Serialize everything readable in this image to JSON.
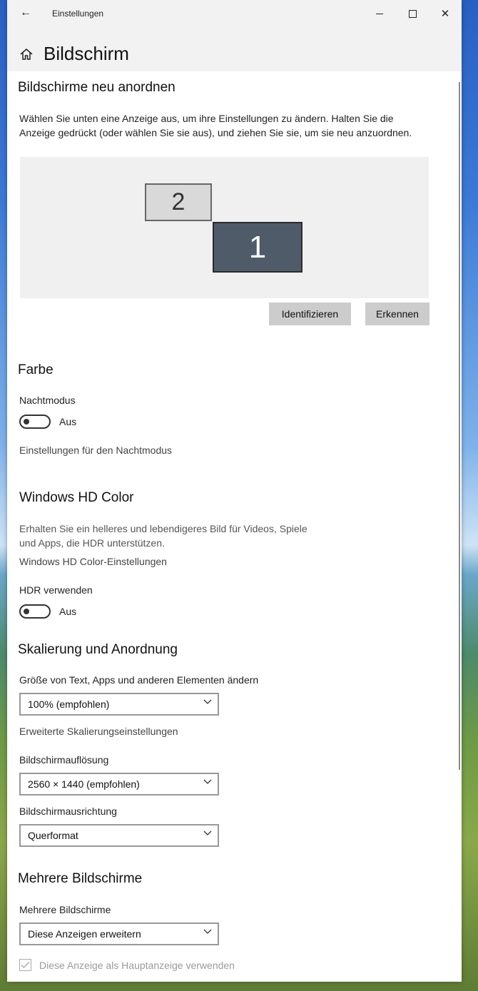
{
  "window": {
    "title": "Einstellungen"
  },
  "page": {
    "title": "Bildschirm"
  },
  "arrange": {
    "heading": "Bildschirme neu anordnen",
    "description_line1": "Wählen Sie unten eine Anzeige aus, um ihre Einstellungen zu ändern. Halten Sie die",
    "description_line2": "Anzeige gedrückt (oder wählen Sie sie aus), und ziehen Sie sie, um sie neu anzuordnen.",
    "monitors": [
      {
        "label": "2"
      },
      {
        "label": "1"
      }
    ],
    "identify_button": "Identifizieren",
    "detect_button": "Erkennen"
  },
  "color": {
    "heading": "Farbe",
    "night_mode_label": "Nachtmodus",
    "night_mode_state": "Aus",
    "night_mode_link": "Einstellungen für den Nachtmodus"
  },
  "hdr": {
    "heading": "Windows HD Color",
    "description_line1": "Erhalten Sie ein helleres und lebendigeres Bild für Videos, Spiele",
    "description_line2": "und Apps, die HDR unterstützen.",
    "settings_link": "Windows HD Color-Einstellungen",
    "use_hdr_label": "HDR verwenden",
    "use_hdr_state": "Aus"
  },
  "scale": {
    "heading": "Skalierung und Anordnung",
    "size_label": "Größe von Text, Apps und anderen Elementen ändern",
    "size_value": "100% (empfohlen)",
    "advanced_link": "Erweiterte Skalierungseinstellungen",
    "resolution_label": "Bildschirmauflösung",
    "resolution_value": "2560 × 1440 (empfohlen)",
    "orientation_label": "Bildschirmausrichtung",
    "orientation_value": "Querformat"
  },
  "multi": {
    "heading": "Mehrere Bildschirme",
    "label": "Mehrere Bildschirme",
    "value": "Diese Anzeigen erweitern",
    "main_display_label": "Diese Anzeige als Hauptanzeige verwenden"
  },
  "icons": {
    "back": "back-arrow-icon",
    "home": "home-icon",
    "chevron": "chevron-down-icon",
    "check": "checkmark-icon"
  }
}
